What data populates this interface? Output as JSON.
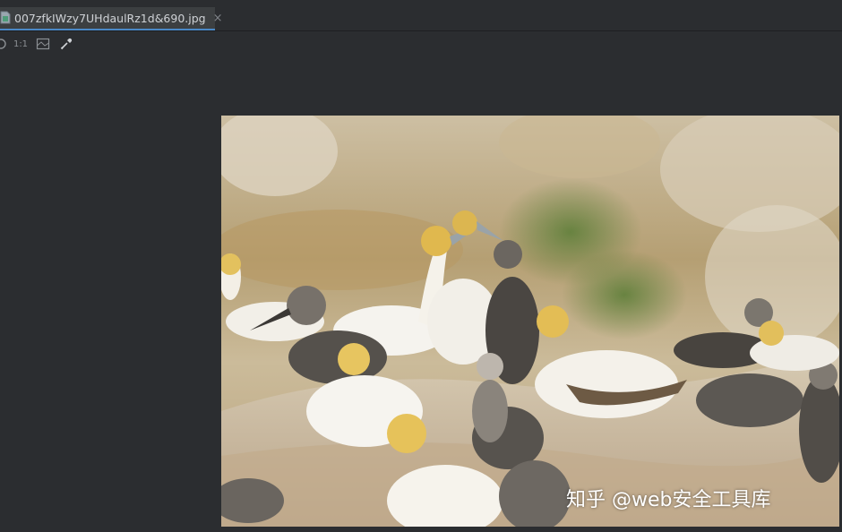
{
  "tab": {
    "filename": "007zfkIWzy7UHdaulRz1d&690.jpg",
    "close_glyph": "×",
    "file_icon": "image-file-icon"
  },
  "toolbar": {
    "zoom_fit_icon": "zoom-to-fit-icon",
    "actual_size_label": "1:1",
    "grid_icon": "toggle-grid-icon",
    "color_picker_icon": "eyedropper-icon"
  },
  "image": {
    "watermark": "知乎 @web安全工具库"
  },
  "colors": {
    "background": "#2b2d30",
    "tab_active": "#3c3f41",
    "tab_accent": "#4a88c7"
  }
}
